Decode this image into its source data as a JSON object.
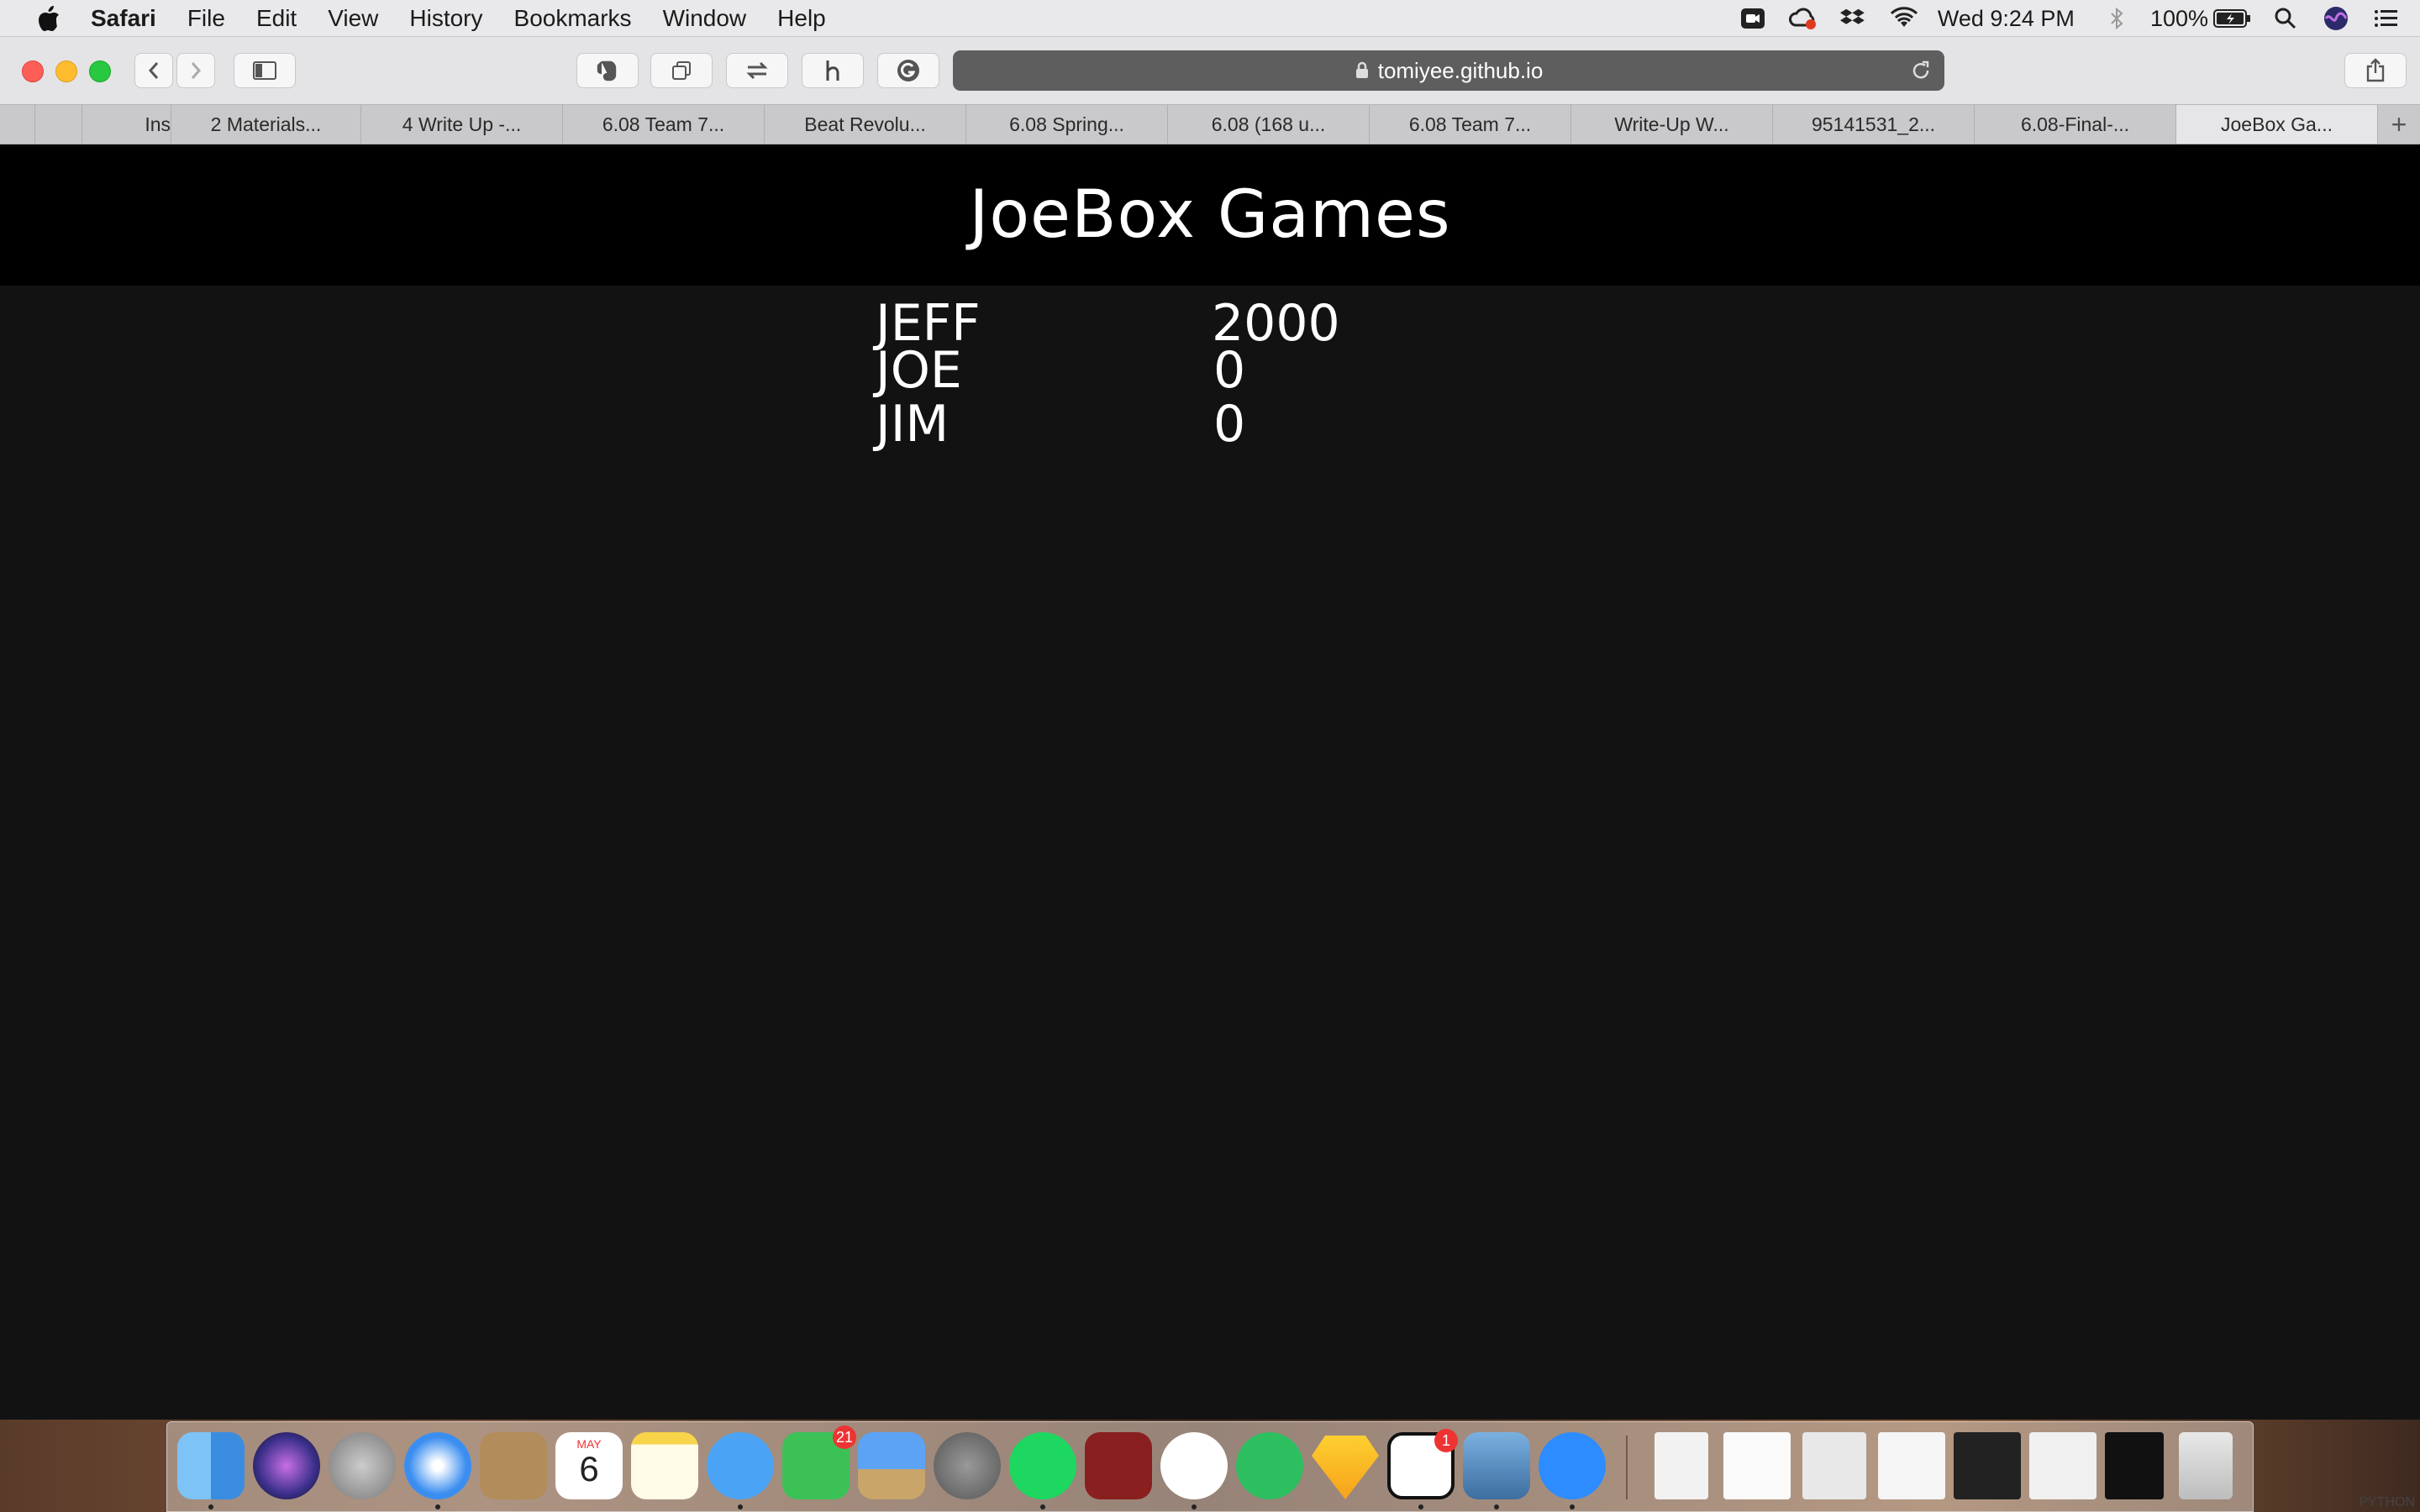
{
  "menubar": {
    "app": "Safari",
    "items": [
      "File",
      "Edit",
      "View",
      "History",
      "Bookmarks",
      "Window",
      "Help"
    ],
    "status": {
      "clock": "Wed 9:24 PM",
      "battery": "100%"
    }
  },
  "browser": {
    "url": "tomiyee.github.io",
    "tabs": [
      {
        "label": ""
      },
      {
        "label": "Ins"
      },
      {
        "label": "2 Materials..."
      },
      {
        "label": "4 Write Up -..."
      },
      {
        "label": "6.08 Team 7..."
      },
      {
        "label": "Beat Revolu..."
      },
      {
        "label": "6.08 Spring..."
      },
      {
        "label": "6.08 (168 u..."
      },
      {
        "label": "6.08 Team 7..."
      },
      {
        "label": "Write-Up W..."
      },
      {
        "label": "95141531_2..."
      },
      {
        "label": "6.08-Final-..."
      },
      {
        "label": "JoeBox Ga..."
      }
    ],
    "new_tab_label": "+"
  },
  "page": {
    "title": "JoeBox Games",
    "scores": [
      {
        "name": "JEFF",
        "score": "2000"
      },
      {
        "name": "JOE",
        "score": "0"
      },
      {
        "name": "JIM",
        "score": "0"
      }
    ]
  },
  "dock": {
    "apps": [
      "finder-icon",
      "siri-icon",
      "launchpad-icon",
      "safari-icon",
      "contacts-icon",
      "calendar-icon",
      "notes-icon",
      "messages-icon",
      "facetime-icon",
      "keynote-icon",
      "system-preferences-icon",
      "spotify-icon",
      "photo-booth-icon",
      "slack-icon",
      "evernote-icon",
      "sketch-icon",
      "notion-icon",
      "preview-icon",
      "zoom-icon"
    ],
    "calendar": {
      "month": "MAY",
      "day": "6"
    },
    "facetime_badge": "21",
    "notion_badge": "1",
    "corner_text": "PYTHON"
  }
}
